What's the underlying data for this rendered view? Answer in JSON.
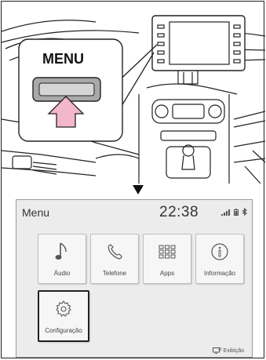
{
  "callout": {
    "menu_label": "MENU"
  },
  "screen": {
    "title": "Menu",
    "clock": "22:38",
    "tiles": [
      {
        "label": "Áudio",
        "icon": "music-note-icon"
      },
      {
        "label": "Telefone",
        "icon": "phone-icon"
      },
      {
        "label": "Apps",
        "icon": "apps-grid-icon"
      },
      {
        "label": "Informação",
        "icon": "info-icon"
      },
      {
        "label": "Configuração",
        "icon": "settings-gear-icon"
      }
    ],
    "footer_button": "Exibição"
  }
}
